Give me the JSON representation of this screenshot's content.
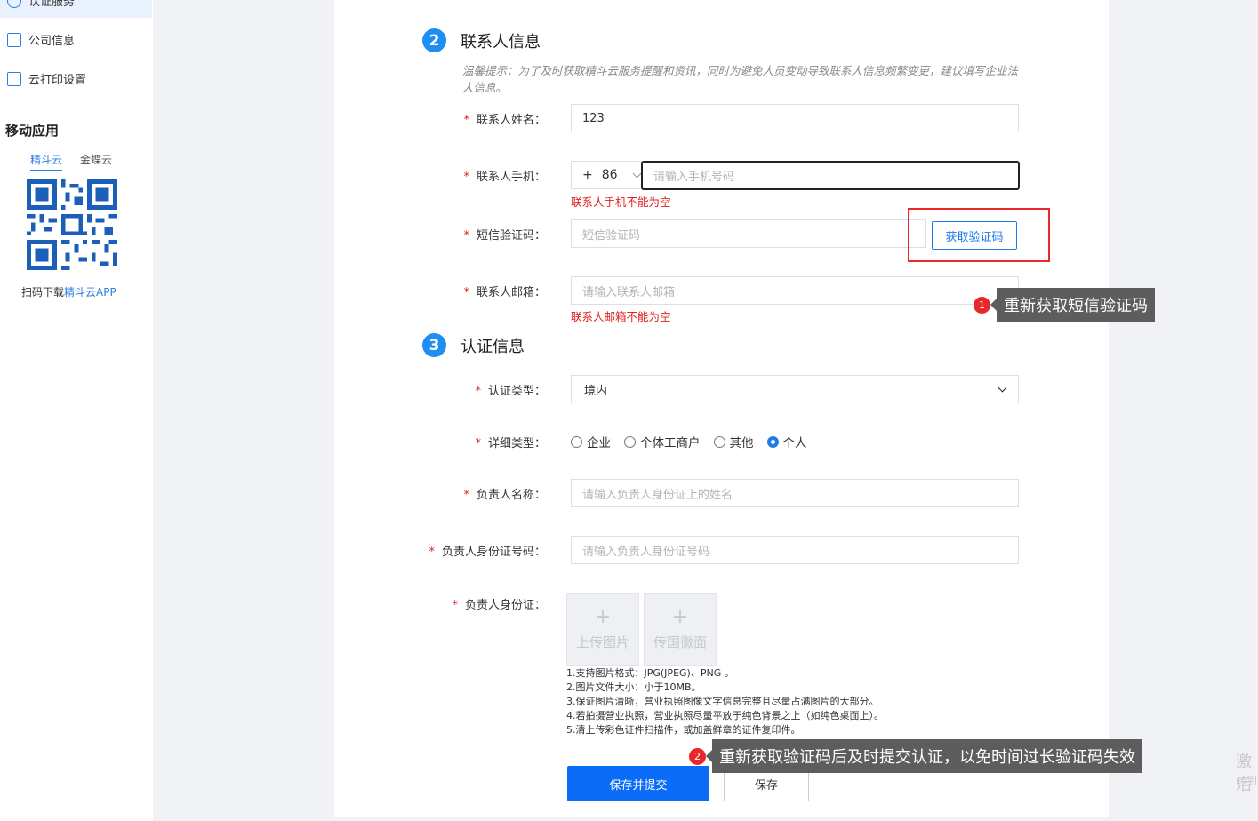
{
  "sidebar": {
    "items": [
      {
        "label": "认证服务",
        "icon": "target-icon"
      },
      {
        "label": "公司信息",
        "icon": "document-icon"
      },
      {
        "label": "云打印设置",
        "icon": "printer-icon"
      }
    ],
    "mobile_title": "移动应用",
    "app_tabs": [
      "精斗云",
      "金蝶云"
    ],
    "qr_caption_prefix": "扫码下载",
    "qr_caption_link": "精斗云APP"
  },
  "section2": {
    "number": "2",
    "title": "联系人信息",
    "hint": "温馨提示：为了及时获取精斗云服务提醒和资讯，同时为避免人员变动导致联系人信息频繁变更，建议填写企业法人信息。",
    "fields": {
      "name_label": "联系人姓名：",
      "name_value": "123",
      "phone_label": "联系人手机：",
      "phone_prefix_plus": "+",
      "phone_prefix_code": "86",
      "phone_placeholder": "请输入手机号码",
      "phone_error": "联系人手机不能为空",
      "sms_label": "短信验证码：",
      "sms_placeholder": "短信验证码",
      "sms_button": "获取验证码",
      "email_label": "联系人邮箱：",
      "email_placeholder": "请输入联系人邮箱",
      "email_error": "联系人邮箱不能为空"
    }
  },
  "section3": {
    "number": "3",
    "title": "认证信息",
    "fields": {
      "type_label": "认证类型：",
      "type_value": "境内",
      "detail_label": "详细类型：",
      "detail_options": [
        {
          "label": "企业",
          "checked": false
        },
        {
          "label": "个体工商户",
          "checked": false
        },
        {
          "label": "其他",
          "checked": false
        },
        {
          "label": "个人",
          "checked": true
        }
      ],
      "owner_name_label": "负责人名称：",
      "owner_name_placeholder": "请输入负责人身份证上的姓名",
      "owner_id_label": "负责人身份证号码：",
      "owner_id_placeholder": "请输入负责人身份证号码",
      "owner_idcard_label": "负责人身份证：",
      "upload_front": "上传图片",
      "upload_back": "传国徽面",
      "rules": [
        "1.支持图片格式：JPG(JPEG)、PNG 。",
        "2.图片文件大小：小于10MB。",
        "3.保证图片清晰，营业执照图像文字信息完整且尽量占满图片的大部分。",
        "4.若拍摄营业执照，营业执照尽量平放于纯色背景之上（如纯色桌面上）。",
        "5.清上传彩色证件扫描件，或加盖鲜章的证件复印件。"
      ]
    }
  },
  "actions": {
    "submit": "保存并提交",
    "save": "保存"
  },
  "callouts": [
    {
      "num": "1",
      "text": "重新获取短信验证码"
    },
    {
      "num": "2",
      "text": "重新获取验证码后及时提交认证，以免时间过长验证码失效"
    }
  ],
  "watermark": {
    "line1": "激活",
    "line2": "转到"
  },
  "colors": {
    "accent": "#1e8ef2",
    "primary_button": "#0a6cf7",
    "error": "#e02020",
    "highlight_box": "#e8262c",
    "tooltip": "#5d5d5d"
  }
}
